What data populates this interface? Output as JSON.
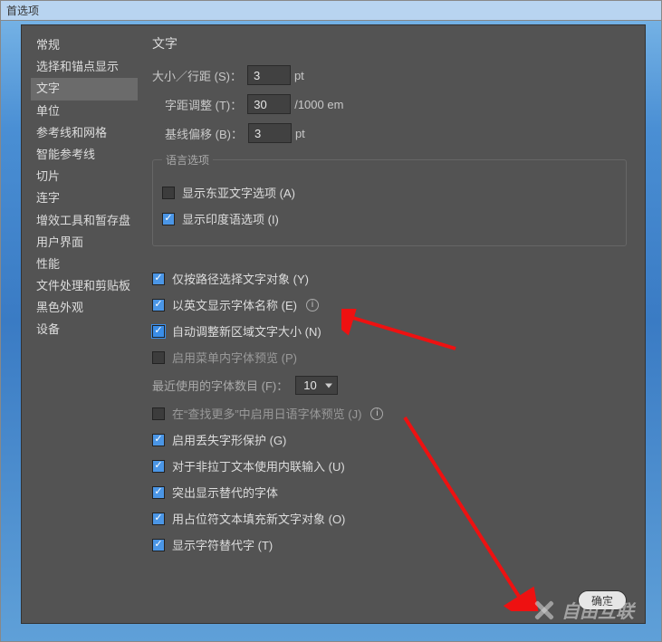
{
  "titlebar": "首选项",
  "sidebar": {
    "items": [
      {
        "label": "常规"
      },
      {
        "label": "选择和锚点显示"
      },
      {
        "label": "文字",
        "selected": true
      },
      {
        "label": "单位"
      },
      {
        "label": "参考线和网格"
      },
      {
        "label": "智能参考线"
      },
      {
        "label": "切片"
      },
      {
        "label": "连字"
      },
      {
        "label": "增效工具和暂存盘"
      },
      {
        "label": "用户界面"
      },
      {
        "label": "性能"
      },
      {
        "label": "文件处理和剪贴板"
      },
      {
        "label": "黑色外观"
      },
      {
        "label": "设备"
      }
    ]
  },
  "main": {
    "title": "文字",
    "sizeRow": {
      "label": "大小／行距 (S)：",
      "value": "3",
      "unit": "pt"
    },
    "trackRow": {
      "label": "字距调整 (T)：",
      "value": "30",
      "unit": "/1000 em"
    },
    "baselineRow": {
      "label": "基线偏移 (B)：",
      "value": "3",
      "unit": "pt"
    },
    "langGroup": {
      "legend": "语言选项",
      "east": {
        "label": "显示东亚文字选项 (A)",
        "checked": false
      },
      "indic": {
        "label": "显示印度语选项 (I)",
        "checked": true
      }
    },
    "checks": {
      "pathOnly": {
        "label": "仅按路径选择文字对象 (Y)",
        "checked": true
      },
      "engFont": {
        "label": "以英文显示字体名称 (E)",
        "checked": true,
        "info": true
      },
      "autoResize": {
        "label": "自动调整新区域文字大小 (N)",
        "checked": true,
        "highlight": true
      },
      "menuPreview": {
        "label": "启用菜单内字体预览 (P)",
        "checked": false
      },
      "recentFonts": {
        "label": "最近使用的字体数目 (F)：",
        "value": "10"
      },
      "jpFind": {
        "label": "在“查找更多”中启用日语字体预览 (J)",
        "checked": false,
        "info": true
      },
      "missing": {
        "label": "启用丢失字形保护 (G)",
        "checked": true
      },
      "inline": {
        "label": "对于非拉丁文本使用内联输入 (U)",
        "checked": true
      },
      "alternates": {
        "label": "突出显示替代的字体",
        "checked": true
      },
      "placeholder": {
        "label": "用占位符文本填充新文字对象 (O)",
        "checked": true
      },
      "glyphAlt": {
        "label": "显示字符替代字 (T)",
        "checked": true
      }
    }
  },
  "footer": {
    "ok": "确定"
  },
  "watermark": "自由互联"
}
